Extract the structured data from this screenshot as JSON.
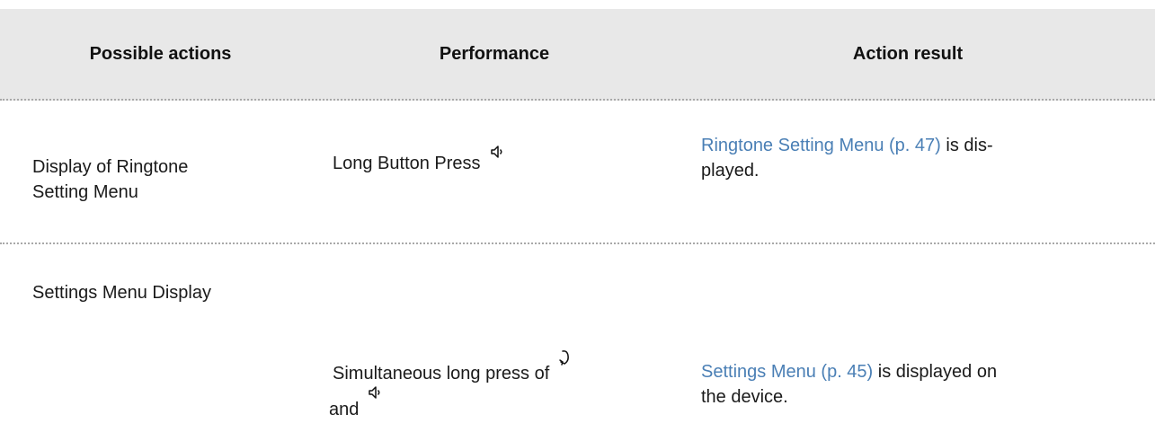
{
  "table": {
    "headers": {
      "actions": "Possible actions",
      "performance": "Performance",
      "result": "Action result"
    },
    "rows": [
      {
        "action": "Display of Ringtone Setting Menu",
        "action_line1": "Display of Ringtone",
        "action_line2": "Setting Menu",
        "performance_text": "Long Button Press",
        "performance_icon": "speaker-icon",
        "result_link": "Ringtone Setting Menu (p. 47)",
        "result_text_line1": " is dis-",
        "result_text_line2": "played."
      },
      {
        "action": "Settings Menu Display",
        "performance_text_line1": "Simultaneous long press of",
        "performance_icon1": "handset-icon",
        "performance_text_line2": "and",
        "performance_icon2": "speaker-icon",
        "result_link": "Settings Menu (p. 45)",
        "result_text_line1": " is displayed on",
        "result_text_line2": "the device."
      }
    ]
  },
  "colors": {
    "header_bg": "#e8e8e8",
    "link": "#4a7fb5",
    "divider": "#a8a8a8"
  }
}
